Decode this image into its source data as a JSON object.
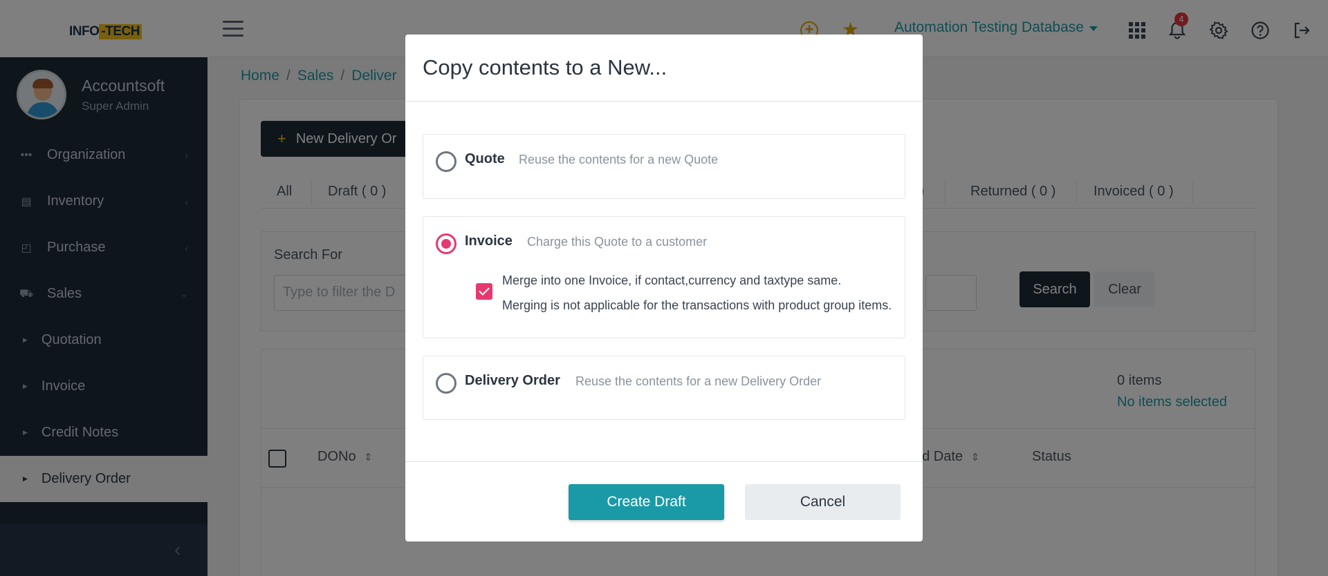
{
  "header": {
    "logo_part1": "INFO",
    "logo_part2": "-TECH",
    "database": "Automation Testing Database",
    "notification_count": "4"
  },
  "sidebar": {
    "user_name": "Accountsoft",
    "user_role": "Super Admin",
    "items": [
      {
        "label": "Organization",
        "icon": "dots-icon"
      },
      {
        "label": "Inventory",
        "icon": "inventory-icon"
      },
      {
        "label": "Purchase",
        "icon": "bag-icon"
      },
      {
        "label": "Sales",
        "icon": "cart-icon"
      }
    ],
    "sub_items": [
      "Quotation",
      "Invoice",
      "Credit Notes",
      "Delivery Order"
    ],
    "active_sub_item": "Delivery Order"
  },
  "breadcrumb": [
    "Home",
    "Sales",
    "Deliver"
  ],
  "main": {
    "new_button": "New Delivery Or",
    "tabs": [
      {
        "label": "All"
      },
      {
        "label": "Draft ( 0 )"
      },
      {
        "label": "0 )"
      },
      {
        "label": "Returned ( 0 )"
      },
      {
        "label": "Invoiced ( 0 )"
      }
    ],
    "search_label": "Search For",
    "search_placeholder": "Type to filter the D",
    "search_button": "Search",
    "clear_button": "Clear",
    "items_count": "0 items",
    "items_selected": "No items selected",
    "columns": [
      "DONo",
      "ed Date",
      "Status"
    ]
  },
  "modal": {
    "title": "Copy contents to a New...",
    "options": [
      {
        "title": "Quote",
        "description": "Reuse the contents for a new Quote",
        "selected": false
      },
      {
        "title": "Invoice",
        "description": "Charge this Quote to a customer",
        "selected": true
      },
      {
        "title": "Delivery Order",
        "description": "Reuse the contents for a new Delivery Order",
        "selected": false
      }
    ],
    "merge_line1": "Merge into one Invoice, if contact,currency and taxtype same.",
    "merge_line2": "Merging is not applicable for the transactions with product group items.",
    "merge_checked": true,
    "create_button": "Create Draft",
    "cancel_button": "Cancel"
  },
  "colors": {
    "accent_teal": "#1a9aa6",
    "radio_pink": "#e5396f",
    "sidebar_bg": "#1d2a37",
    "brand_yellow": "#f4c11a"
  }
}
